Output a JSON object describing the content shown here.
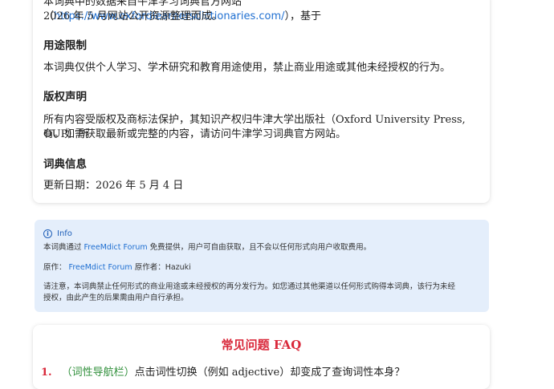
{
  "source": {
    "line1_before": "本词典中的数据来自牛津学习词典官方网站（",
    "url": "https://www.oxfordlearnersdictionaries.com/",
    "line1_after": "），基于",
    "line2": "2026 年 5 月网站公开资源整理而成。"
  },
  "usage": {
    "heading": "用途限制",
    "text": "本词典仅供个人学习、学术研究和教育用途使用，禁止商业用途或其他未经授权的行为。"
  },
  "copyright": {
    "heading": "版权声明",
    "line1": "所有内容受版权及商标法保护，其知识产权归牛津大学出版社（Oxford University Press, OUP）所",
    "line2": "有。如需获取最新或完整的内容，请访问牛津学习词典官方网站。"
  },
  "dict_info": {
    "heading": "词典信息",
    "updated": "更新日期：2026 年 5 月 4 日"
  },
  "info_box": {
    "title": "Info",
    "icon": "info-icon",
    "line1_before": "本词典通过 ",
    "forum_link": "FreeMdict Forum",
    "line1_after": " 免费提供，用户可自由获取，且不会以任何形式向用户收取费用。",
    "origin_label": "原作：",
    "origin_link": "FreeMdict Forum",
    "author_label": " 原作者：",
    "author": "Hazuki",
    "notice_line1": "请注意，本词典禁止任何形式的商业用途或未经授权的再分发行为。如您通过其他渠道以任何形式购得本词典，该行为未经",
    "notice_line2": "授权，由此产生的后果需由用户自行承担。",
    "colors": {
      "background": "#e4eefb",
      "accent": "#1f5fb8"
    }
  },
  "faq": {
    "title": "常见问题 FAQ",
    "items": [
      {
        "num": "1.",
        "tag": "（词性导航栏）",
        "question": "点击词性切换（例如 adjective）却变成了查询词性本身？"
      }
    ],
    "colors": {
      "title": "#d9283a",
      "tag": "#2f8f3a"
    }
  }
}
